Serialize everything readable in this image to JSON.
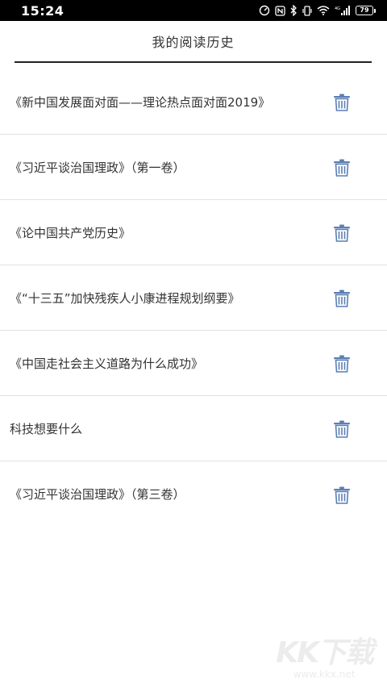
{
  "status_bar": {
    "time": "15:24",
    "battery": "79",
    "network": "4G"
  },
  "header": {
    "title": "我的阅读历史"
  },
  "history": {
    "items": [
      {
        "title": "《新中国发展面对面——理论热点面对面2019》"
      },
      {
        "title": "《习近平谈治国理政》（第一卷）"
      },
      {
        "title": "《论中国共产党历史》"
      },
      {
        "title": "《“十三五”加快残疾人小康进程规划纲要》"
      },
      {
        "title": "《中国走社会主义道路为什么成功》"
      },
      {
        "title": "科技想要什么"
      },
      {
        "title": "《习近平谈治国理政》（第三卷）"
      }
    ]
  },
  "icons": {
    "delete": "trash-icon"
  },
  "colors": {
    "status_bar_bg": "#000000",
    "icon_blue": "#5b7fb4",
    "divider": "#e2e2e2",
    "header_line": "#222222"
  },
  "watermark": {
    "logo": "KK下载",
    "url": "www.kkx.net"
  }
}
